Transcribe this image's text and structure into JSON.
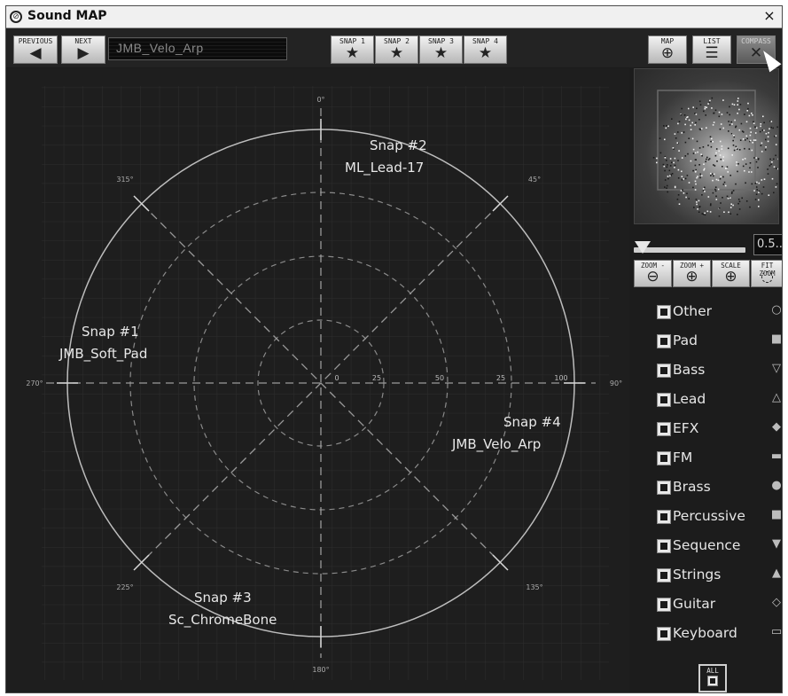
{
  "window": {
    "title": "Sound MAP",
    "close_glyph": "×"
  },
  "toolbar": {
    "previous_label": "PREVIOUS",
    "next_label": "NEXT",
    "preset_name": "JMB_Velo_Arp",
    "snaps": [
      {
        "label": "SNAP 1"
      },
      {
        "label": "SNAP 2"
      },
      {
        "label": "SNAP 3"
      },
      {
        "label": "SNAP 4"
      }
    ],
    "views": [
      {
        "label": "MAP",
        "icon": "map-icon"
      },
      {
        "label": "LIST",
        "icon": "list-icon"
      },
      {
        "label": "COMPASS",
        "icon": "compass-icon"
      }
    ]
  },
  "compass": {
    "angles": {
      "a0": "0°",
      "a45": "45°",
      "a90": "90°",
      "a135": "135°",
      "a180": "180°",
      "a225": "225°",
      "a270": "270°",
      "a315": "315°"
    },
    "ring_labels": {
      "r0": "0",
      "r25a": "25",
      "r50": "50",
      "r25b": "25",
      "r100": "100"
    },
    "snaps": [
      {
        "title": "Snap #1",
        "preset": "JMB_Soft_Pad"
      },
      {
        "title": "Snap #2",
        "preset": "ML_Lead-17"
      },
      {
        "title": "Snap #3",
        "preset": "Sc_ChromeBone"
      },
      {
        "title": "Snap #4",
        "preset": "JMB_Velo_Arp"
      }
    ]
  },
  "zoom": {
    "value_text": "0.5...",
    "buttons": [
      {
        "label": "ZOOM -",
        "icon": "zoom-out-icon"
      },
      {
        "label": "ZOOM +",
        "icon": "zoom-in-icon"
      },
      {
        "label": "SCALE",
        "icon": "scale-icon"
      },
      {
        "label": "FIT ZOOM",
        "icon": "fit-zoom-icon"
      }
    ]
  },
  "categories": [
    {
      "label": "Other",
      "icon": "circle-outline-icon",
      "glyph": "○"
    },
    {
      "label": "Pad",
      "icon": "square-icon",
      "glyph": "■"
    },
    {
      "label": "Bass",
      "icon": "triangle-down-outline-icon",
      "glyph": "▽"
    },
    {
      "label": "Lead",
      "icon": "triangle-up-outline-icon",
      "glyph": "△"
    },
    {
      "label": "EFX",
      "icon": "diamond-icon",
      "glyph": "◆"
    },
    {
      "label": "FM",
      "icon": "rectangle-icon",
      "glyph": "▬"
    },
    {
      "label": "Brass",
      "icon": "circle-icon",
      "glyph": "●"
    },
    {
      "label": "Percussive",
      "icon": "square-icon",
      "glyph": "■"
    },
    {
      "label": "Sequence",
      "icon": "triangle-down-icon",
      "glyph": "▼"
    },
    {
      "label": "Strings",
      "icon": "triangle-up-icon",
      "glyph": "▲"
    },
    {
      "label": "Guitar",
      "icon": "diamond-outline-icon",
      "glyph": "◇"
    },
    {
      "label": "Keyboard",
      "icon": "rectangle-outline-icon",
      "glyph": "▭"
    }
  ],
  "all_button": {
    "label": "ALL"
  }
}
